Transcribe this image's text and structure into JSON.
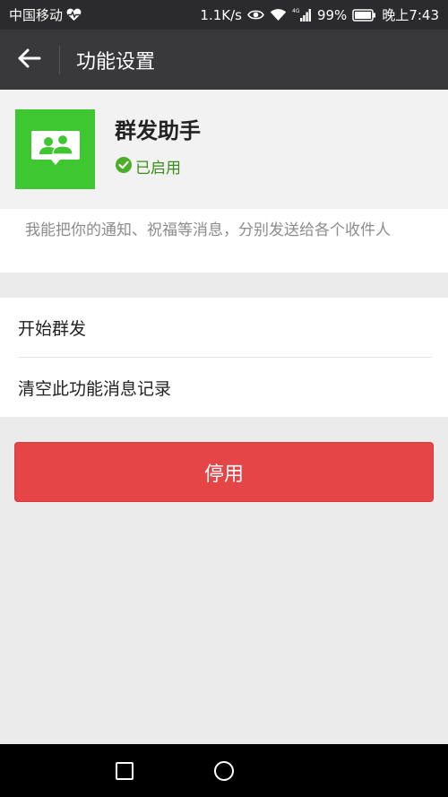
{
  "status_bar": {
    "carrier": "中国移动",
    "speed": "1.1K/s",
    "network": "4G",
    "battery": "99%",
    "time": "晚上7:43"
  },
  "app_bar": {
    "title": "功能设置"
  },
  "profile": {
    "name": "群发助手",
    "status": "已启用"
  },
  "description": "我能把你的通知、祝福等消息，分别发送给各个收件人",
  "menu": {
    "items": [
      {
        "label": "开始群发"
      },
      {
        "label": "清空此功能消息记录"
      }
    ]
  },
  "disable_button": {
    "label": "停用",
    "color": "#e54547"
  },
  "colors": {
    "status_bar_bg": "#2b2b2d",
    "app_bar_bg": "#39393c",
    "icon_green": "#3fc732",
    "enabled_green": "#3a8d1d"
  }
}
